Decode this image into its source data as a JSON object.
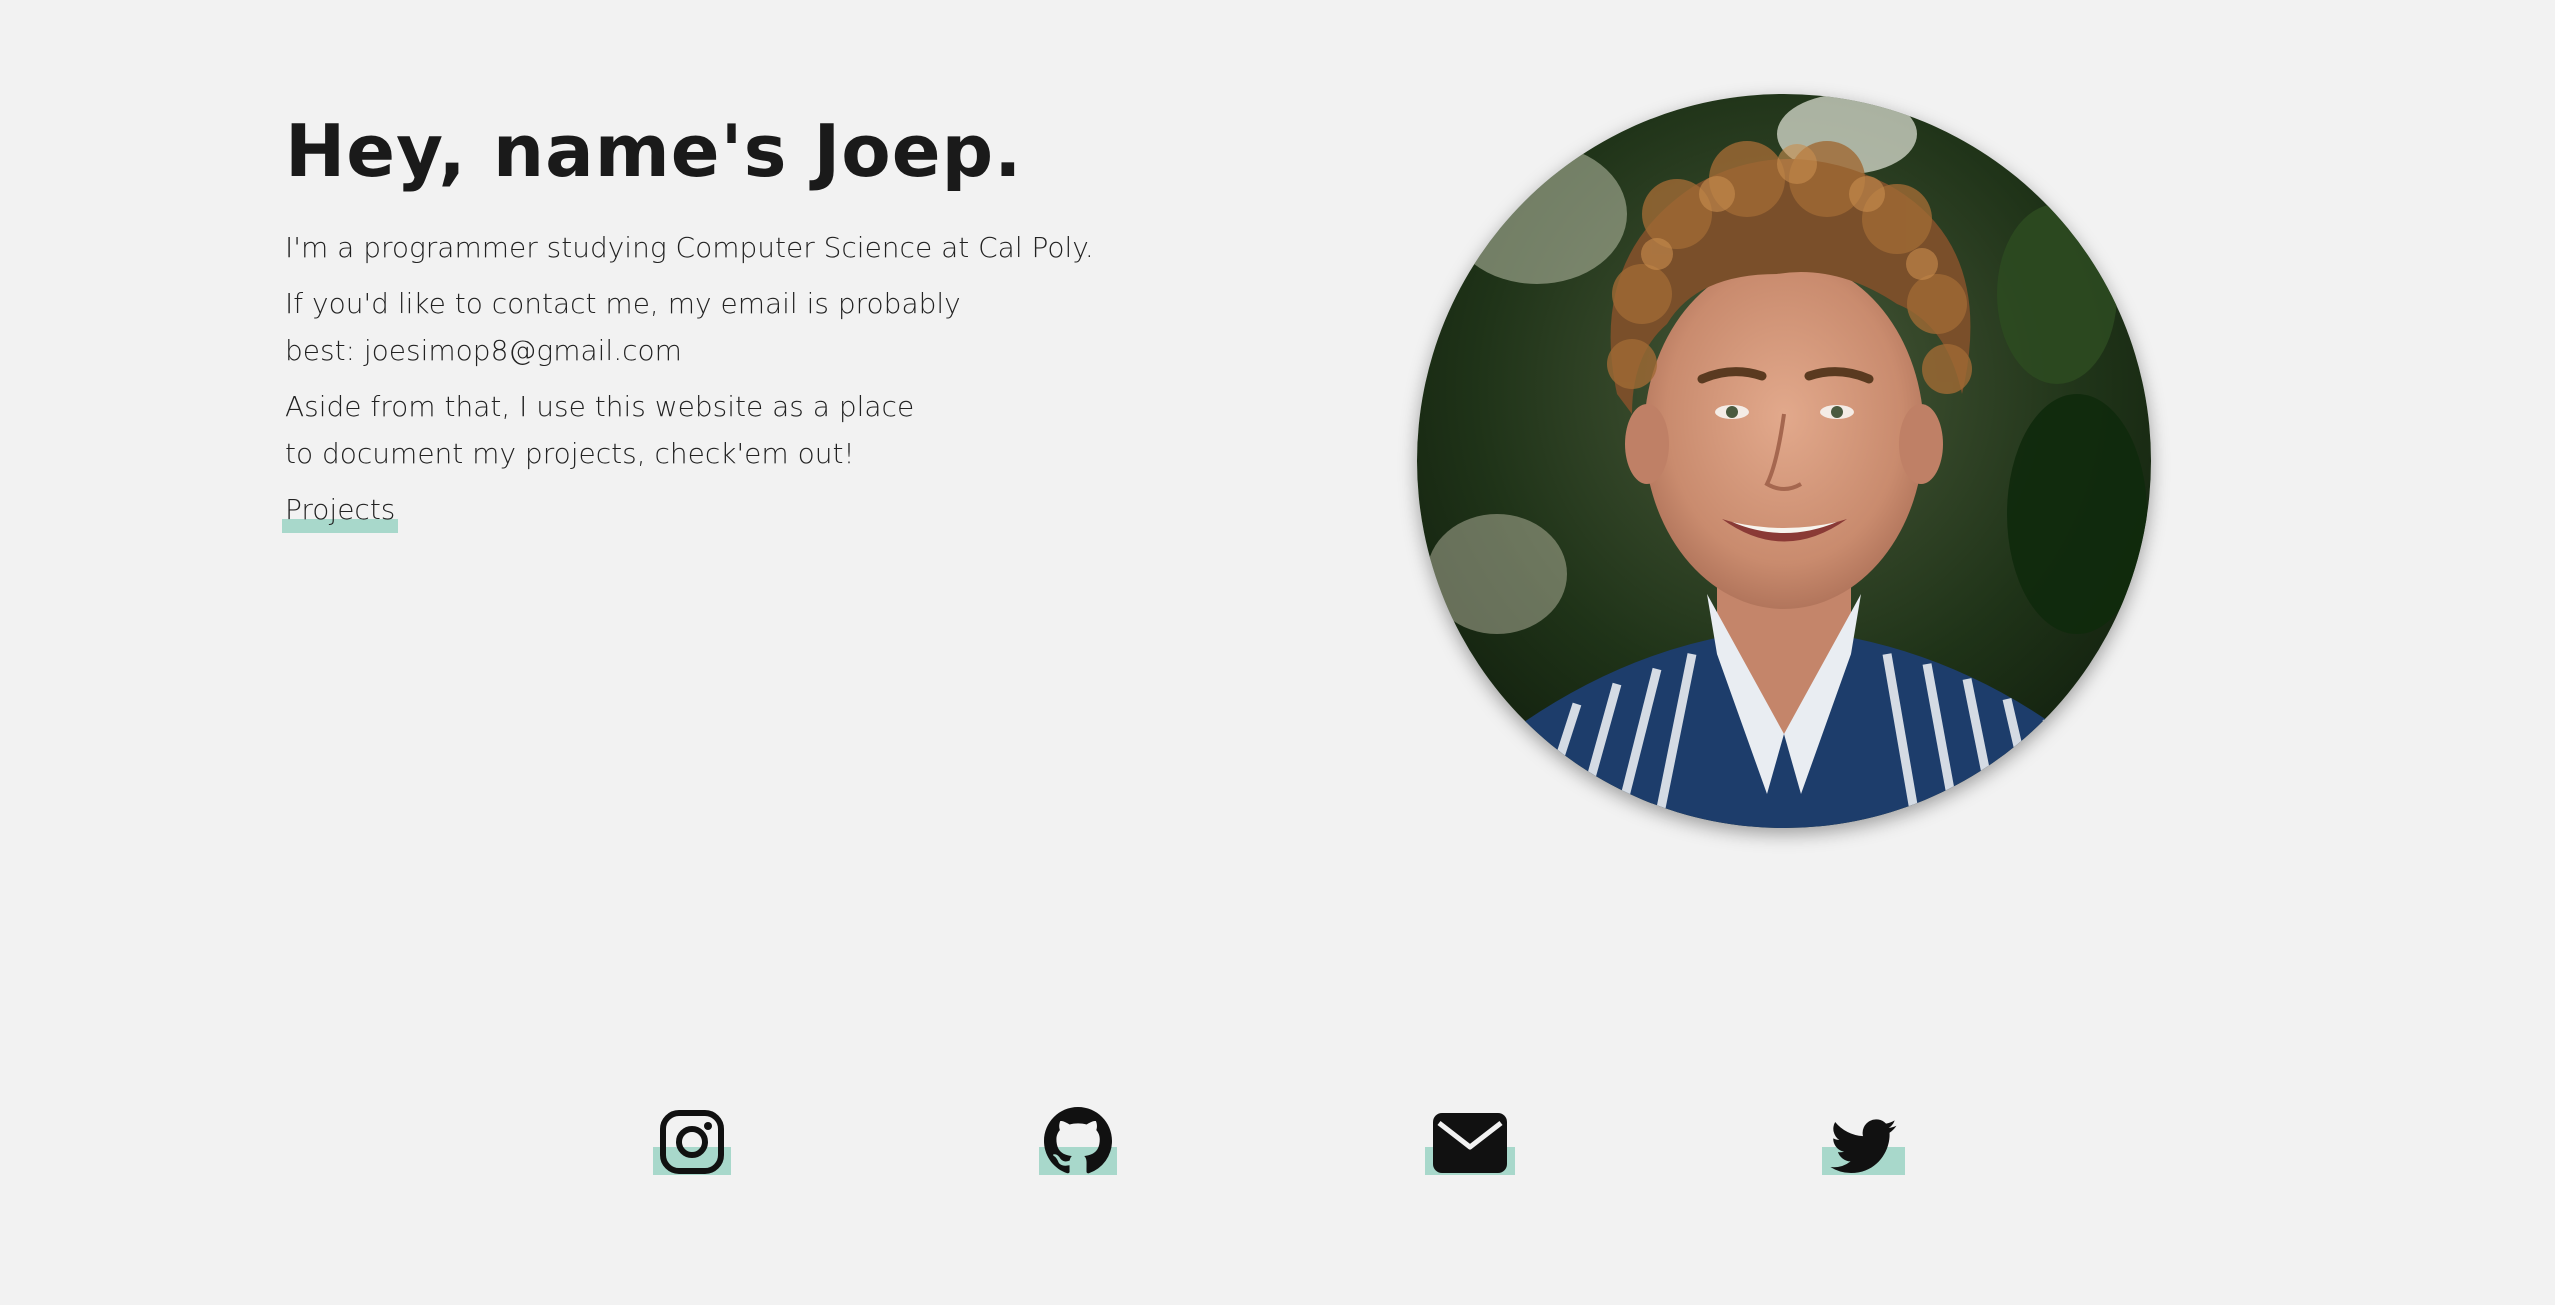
{
  "intro": {
    "headline": "Hey, name's Joep.",
    "line1": "I'm a programmer studying Computer Science at Cal Poly.",
    "line2": "If you'd like to contact me, my email is probably best: joesimop8@gmail.com",
    "line3": "Aside from that, I use this website as a place to document my projects, check'em out!",
    "projects_link": "Projects"
  },
  "social": [
    {
      "icon": "instagram-icon"
    },
    {
      "icon": "github-icon"
    },
    {
      "icon": "email-icon"
    },
    {
      "icon": "twitter-icon"
    }
  ],
  "colors": {
    "background": "#f2f2f2",
    "text": "#1a1a1a",
    "accent_highlight": "#a8d8cb"
  }
}
